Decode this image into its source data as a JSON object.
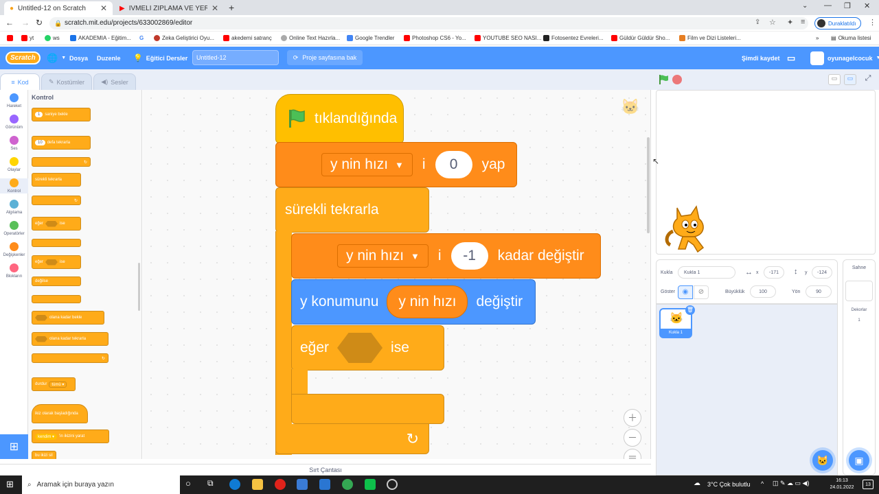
{
  "browser": {
    "tabs": [
      {
        "title": "Untitled-12 on Scratch",
        "active": true
      },
      {
        "title": "İVMELİ ZIPLAMA VE YER ÇEKİMİ",
        "active": false
      }
    ],
    "url": "scratch.mit.edu/projects/633002869/editor",
    "profile_label": "Duraklatıldı",
    "bookmarks": [
      "yt",
      "ws",
      "AKADEMIA - Eğitim...",
      "Zeka Geliştirici Oyu...",
      "akedemi satranç",
      "Online Text Hazırla...",
      "Google Trendler",
      "Photoshop CS6 - Yo...",
      "YOUTUBE SEO NASI...",
      "Fotosentez Evreleri...",
      "Güldür Güldür Sho...",
      "Film ve Dizi Listeleri..."
    ],
    "reading_list": "Okuma listesi"
  },
  "menubar": {
    "logo": "Scratch",
    "file": "Dosya",
    "edit": "Duzenle",
    "tutorials": "Eğitici Dersler",
    "project_title": "Untitled-12",
    "see_project": "Proje sayfasına bak",
    "save_now": "Şimdi kaydet",
    "username": "oyunagelcocuk"
  },
  "editor_tabs": {
    "code": "Kod",
    "costumes": "Kostümler",
    "sounds": "Sesler"
  },
  "categories": [
    {
      "label": "Hareket",
      "color": "#4c97ff"
    },
    {
      "label": "Görünüm",
      "color": "#9966ff"
    },
    {
      "label": "Ses",
      "color": "#cf63cf"
    },
    {
      "label": "Olaylar",
      "color": "#ffd500"
    },
    {
      "label": "Kontrol",
      "color": "#ffab19"
    },
    {
      "label": "Algılama",
      "color": "#5cb1d6"
    },
    {
      "label": "Operatörler",
      "color": "#59c059"
    },
    {
      "label": "Değişkenler",
      "color": "#ff8c1a"
    },
    {
      "label": "Blokların",
      "color": "#ff6680"
    }
  ],
  "palette": {
    "heading": "Kontrol",
    "wait_value": "1",
    "wait_text": "saniye bekle",
    "repeat_value": "10",
    "repeat_text": "defa tekrarla",
    "forever": "sürekli tekrarla",
    "if1_a": "eğer",
    "if1_b": "ise",
    "if2_a": "eğer",
    "if2_b": "ise",
    "else": "değilse",
    "wait_until": "olana kadar bekle",
    "repeat_until": "olana kadar tekrarla",
    "stop": "durdur",
    "stop_opt": "tümü",
    "clone_start": "ikiz olarak başladığında",
    "clone_target": "kendim",
    "clone_text": "'in ikizini yarat",
    "delete_clone": "bu ikizi sil"
  },
  "script": {
    "hat": "tıklandığında",
    "set_var": "y nin hızı",
    "set_mid": "i",
    "set_value": "0",
    "set_end": "yap",
    "forever": "sürekli tekrarla",
    "change_var": "y nin hızı",
    "change_mid": "i",
    "change_value": "-1",
    "change_end": "kadar değiştir",
    "motion_a": "y konumunu",
    "motion_reporter": "y nin hızı",
    "motion_b": "değiştir",
    "if_a": "eğer",
    "if_b": "ise"
  },
  "backpack": "Sırt Çantası",
  "sprite_info": {
    "sprite_label": "Kukla",
    "sprite_name": "Kukla 1",
    "x_label": "x",
    "x": "-171",
    "y_label": "y",
    "y": "-124",
    "show_label": "Göster",
    "size_label": "Büyüklük",
    "size": "100",
    "direction_label": "Yön",
    "direction": "90"
  },
  "sprites": [
    {
      "name": "Kukla 1"
    }
  ],
  "stage_panel": {
    "title": "Sahne",
    "backdrops_label": "Dekorlar",
    "backdrops_count": "1"
  },
  "taskbar": {
    "search_placeholder": "Aramak için buraya yazın",
    "weather": "3°C  Çok bulutlu",
    "time": "16:13",
    "date": "24.01.2022",
    "notifications": "13"
  }
}
